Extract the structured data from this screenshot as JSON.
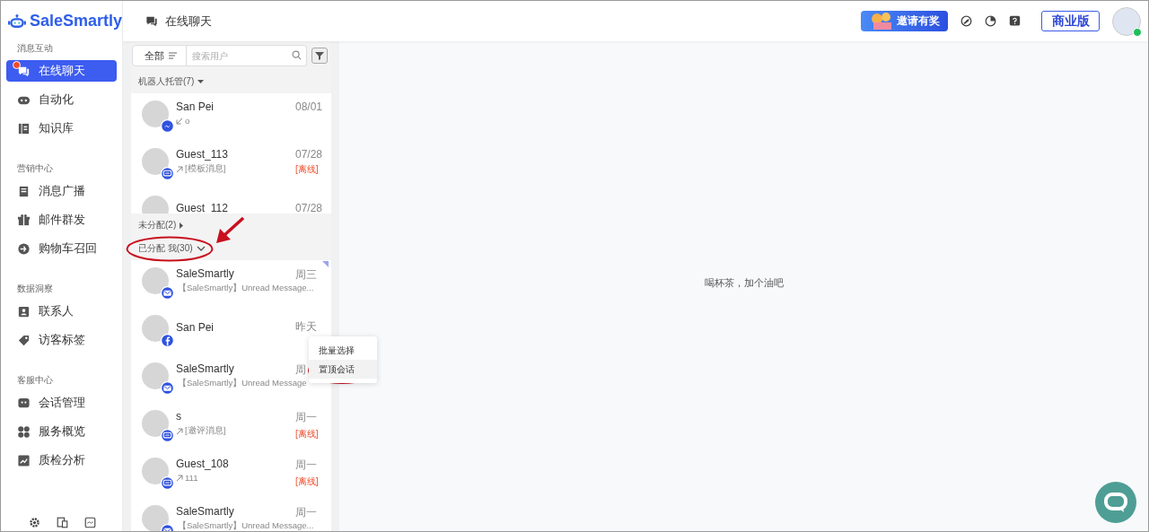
{
  "sidebar": {
    "logo": "SaleSmartly",
    "sections": [
      {
        "title": "消息互动",
        "items": [
          {
            "label": "在线聊天",
            "kind": "chat",
            "selected": true,
            "unread": true
          },
          {
            "label": "自动化",
            "kind": "robot",
            "selected": false,
            "unread": false
          },
          {
            "label": "知识库",
            "kind": "book",
            "selected": false,
            "unread": false
          }
        ]
      },
      {
        "title": "营销中心",
        "items": [
          {
            "label": "消息广播",
            "kind": "broadcast",
            "selected": false,
            "unread": false
          },
          {
            "label": "邮件群发",
            "kind": "gift",
            "selected": false,
            "unread": false
          },
          {
            "label": "购物车召回",
            "kind": "cart",
            "selected": false,
            "unread": false
          }
        ]
      },
      {
        "title": "数据洞察",
        "items": [
          {
            "label": "联系人",
            "kind": "contact",
            "selected": false,
            "unread": false
          },
          {
            "label": "访客标签",
            "kind": "tag",
            "selected": false,
            "unread": false
          }
        ]
      },
      {
        "title": "客服中心",
        "items": [
          {
            "label": "会话管理",
            "kind": "session",
            "selected": false,
            "unread": false
          },
          {
            "label": "服务概览",
            "kind": "grid",
            "selected": false,
            "unread": false
          },
          {
            "label": "质检分析",
            "kind": "chart",
            "selected": false,
            "unread": false
          }
        ]
      }
    ]
  },
  "header": {
    "title": "在线聊天",
    "invite_banner": "邀请有奖",
    "plan_button": "商业版"
  },
  "chat_list": {
    "filter": "全部",
    "search": {
      "placeholder": "搜索用户"
    },
    "groups": [
      {
        "title": "机器人托管(7)",
        "expanded": true,
        "chats": [
          {
            "name": "San Pei",
            "time": "08/01",
            "preview": "o",
            "outgoing": false,
            "kind": "messenger",
            "pinned": false
          },
          {
            "name": "Guest_113",
            "time": "07/28",
            "preview": "[模板消息]",
            "outgoing": true,
            "kind": "chat",
            "offline": "[离线]",
            "pinned": false
          },
          {
            "name": "Guest_112",
            "time": "07/28",
            "pinned": false
          }
        ]
      },
      {
        "title": "未分配(2)",
        "expanded": false
      },
      {
        "title": "已分配  我(30)",
        "expanded": true,
        "chats": [
          {
            "name": "SaleSmartly",
            "time": "周三",
            "preview": "【SaleSmartly】Unread Message...",
            "outgoing": false,
            "kind": "email",
            "pinned": true
          },
          {
            "name": "San Pei",
            "time": "昨天",
            "kind": "facebook",
            "pinned": false
          },
          {
            "name": "SaleSmartly",
            "time": "周",
            "preview": "【SaleSmartly】Unread Message",
            "outgoing": false,
            "kind": "email",
            "pinned": false
          },
          {
            "name": "s",
            "time": "周一",
            "preview": "[邀评消息]",
            "outgoing": true,
            "kind": "chat",
            "offline": "[离线]",
            "pinned": false
          },
          {
            "name": "Guest_108",
            "time": "周一",
            "preview": "111",
            "outgoing": true,
            "kind": "chat",
            "offline": "[离线]",
            "pinned": false
          },
          {
            "name": "SaleSmartly",
            "time": "周一",
            "preview": "【SaleSmartly】Unread Message...",
            "outgoing": false,
            "kind": "email",
            "pinned": false
          }
        ]
      }
    ]
  },
  "context_menu": {
    "items": [
      {
        "label": "批量选择",
        "selected": false
      },
      {
        "label": "置顶会话",
        "selected": true
      }
    ]
  },
  "main": {
    "empty_text": "喝杯茶，加个油吧"
  }
}
